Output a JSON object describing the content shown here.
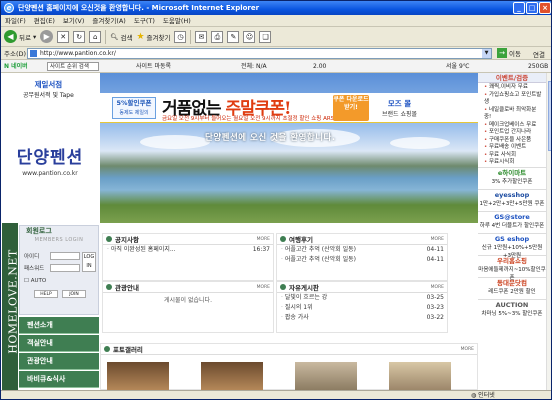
{
  "window": {
    "title": "단양펜션 홈페이지에 오신것을 환영합니다. - Microsoft Internet Explorer",
    "controls": [
      "_",
      "□",
      "×"
    ]
  },
  "menu": [
    "파일(F)",
    "편집(E)",
    "보기(V)",
    "즐겨찾기(A)",
    "도구(T)",
    "도움말(H)"
  ],
  "toolbar": {
    "back": "뒤로",
    "search": "검색",
    "favorites": "즐겨찾기"
  },
  "address": {
    "label": "주소(D)",
    "url": "http://www.pantion.co.kr/",
    "go": "이동",
    "links": "연결"
  },
  "naver": {
    "logo": "N 네이버",
    "search_placeholder": "사이트 순위 검색",
    "site_label": "사이트 마동록",
    "rank": "전체: N/A",
    "zoom": "2.00",
    "weather": "서울 9℃",
    "disk": "250GB"
  },
  "page": {
    "top_link_left": {
      "title": "제일서점",
      "sub": "공무원서적 및 Tape"
    },
    "brand": {
      "name": "단양펜션",
      "url": "www.pantion.co.kr"
    },
    "ad": {
      "badge_line1": "5%할인쿠폰",
      "badge_line2": "동제도 제일의",
      "headline_black": "거품없는 ",
      "headline_red": "주말쿠폰!",
      "sub": "금요일 오전 9시부터 들어오는 월요일 오전 9시까지 초절정 할인 쇼핑 ARS CHANCE",
      "box": "쿠폰 다운로드 받기!",
      "right_title": "모즈 몰",
      "right_sub": "브랜드 쇼핑몰"
    },
    "welcome": "단양펜션에 오신 것을 환영합니다.",
    "right_header": "이벤트/검증",
    "right_links": [
      "쾌찍,이비자 무료",
      "가입쇼핑쇼고 포인트발생",
      "네일클로바 최악화분 중!",
      "메이크업베이스 무료",
      "포인트업 간지나라",
      "구매쿠폰을 사은품",
      "무료배송 이벤트",
      "무료 사식회",
      "무료시식회"
    ],
    "right_ads": [
      {
        "title": "e하이마트",
        "sub": "3% 추가할인쿠폰"
      },
      {
        "title": "eyesshop",
        "sub": "1만+2만+3만+5만원 쿠폰"
      },
      {
        "title": "GS@store",
        "sub": "하루 4번 더블트가 할인쿠폰"
      },
      {
        "title": "GS eshop",
        "sub": "신규 1만원+10%+5만원+3만원"
      },
      {
        "title": "우리홈쇼핑",
        "sub": "마음에들제까지~10%할인쿠폰"
      },
      {
        "title": "동대문닷컴",
        "sub": "레드쿠폰 2만원 할인"
      },
      {
        "title": "AUCTION",
        "sub": "차마닝 5%~3% 할인쿠폰"
      }
    ],
    "vertical_brand": "HOMELOVE.NET",
    "login": {
      "title": "회원로그",
      "banner": "MEMBERS LOGIN",
      "id_label": "아이디",
      "pw_label": "패스워드",
      "login_btn": "LOG IN",
      "auto": "AUTO",
      "help": "HELP",
      "join": "JOIN"
    },
    "nav": [
      "펜션소개",
      "객실안내",
      "관광안내",
      "바비큐&식사"
    ],
    "panels": {
      "notice": {
        "title": "공지사항",
        "more": "MORE",
        "rows": [
          {
            "t": "아직 이완성된 홈페이지...",
            "d": "16:37"
          }
        ]
      },
      "travel": {
        "title": "여행후기",
        "more": "MORE",
        "rows": [
          {
            "t": "어플고간 추억 (산악회 일동)",
            "d": "04-11"
          },
          {
            "t": "어플고간 추억 (산악회 일동)",
            "d": "04-11"
          }
        ]
      },
      "tour": {
        "title": "관광안내",
        "more": "MORE",
        "empty": "게시물이 없습니다."
      },
      "free": {
        "title": "자유게시판",
        "more": "MORE",
        "rows": [
          {
            "t": "달빛이 흐르는 강",
            "d": "03-25"
          },
          {
            "t": "질시의 1위",
            "d": "03-23"
          },
          {
            "t": "팝송 가사",
            "d": "03-22"
          }
        ]
      },
      "gallery": {
        "title": "포토갤러리",
        "more": "MORE"
      }
    }
  },
  "status": {
    "text": "",
    "zone": "인터넷"
  }
}
